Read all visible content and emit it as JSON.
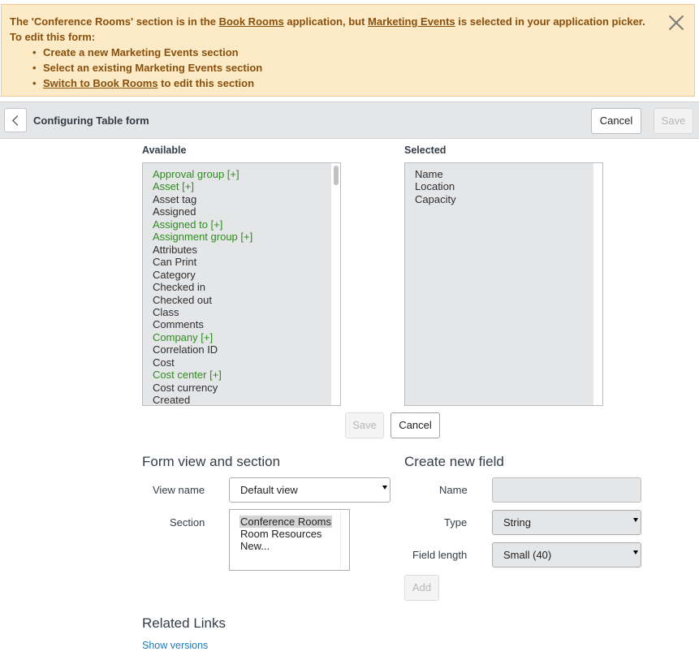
{
  "banner": {
    "msg_prefix": "The 'Conference Rooms' section is in the ",
    "app_link": "Book Rooms",
    "msg_middle": " application, but ",
    "picker_link": "Marketing Events",
    "msg_suffix": " is selected in your application picker. To edit this form:",
    "options": [
      "Create a new Marketing Events section",
      "Select an existing Marketing Events section"
    ],
    "switch_link": "Switch to Book Rooms",
    "switch_suffix": " to edit this section"
  },
  "header": {
    "title": "Configuring Table form",
    "cancel_label": "Cancel",
    "save_label": "Save"
  },
  "slushbucket": {
    "available_label": "Available",
    "selected_label": "Selected",
    "available_items": [
      {
        "label": "Approval group [+]",
        "ref": true
      },
      {
        "label": "Asset [+]",
        "ref": true
      },
      {
        "label": "Asset tag",
        "ref": false
      },
      {
        "label": "Assigned",
        "ref": false
      },
      {
        "label": "Assigned to [+]",
        "ref": true
      },
      {
        "label": "Assignment group [+]",
        "ref": true
      },
      {
        "label": "Attributes",
        "ref": false
      },
      {
        "label": "Can Print",
        "ref": false
      },
      {
        "label": "Category",
        "ref": false
      },
      {
        "label": "Checked in",
        "ref": false
      },
      {
        "label": "Checked out",
        "ref": false
      },
      {
        "label": "Class",
        "ref": false
      },
      {
        "label": "Comments",
        "ref": false
      },
      {
        "label": "Company [+]",
        "ref": true
      },
      {
        "label": "Correlation ID",
        "ref": false
      },
      {
        "label": "Cost",
        "ref": false
      },
      {
        "label": "Cost center [+]",
        "ref": true
      },
      {
        "label": "Cost currency",
        "ref": false
      },
      {
        "label": "Created",
        "ref": false
      }
    ],
    "selected_items": [
      "Name",
      "Location",
      "Capacity"
    ],
    "save_label": "Save",
    "cancel_label": "Cancel"
  },
  "form_view": {
    "heading": "Form view and section",
    "view_name_label": "View name",
    "view_name_value": "Default view",
    "section_label": "Section",
    "sections": [
      "Conference Rooms",
      "Room Resources",
      "New..."
    ],
    "selected_section": "Conference Rooms"
  },
  "new_field": {
    "heading": "Create new field",
    "name_label": "Name",
    "name_value": "",
    "type_label": "Type",
    "type_value": "String",
    "length_label": "Field length",
    "length_value": "Small (40)",
    "add_label": "Add"
  },
  "related_links": {
    "heading": "Related Links",
    "show_versions": "Show versions"
  },
  "colors": {
    "reference_field": "#2d8b1f",
    "banner_bg": "#fcebc6",
    "banner_text": "#8a4f0c",
    "link": "#1f7bb6"
  }
}
